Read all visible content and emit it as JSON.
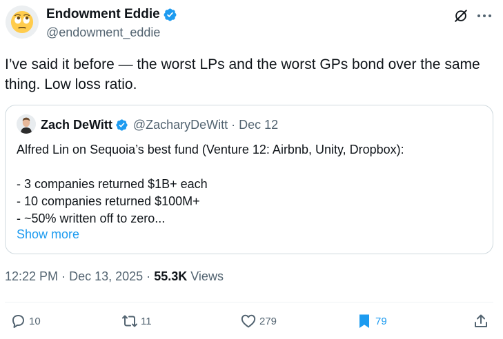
{
  "tweet": {
    "author": {
      "name": "Endowment Eddie",
      "handle": "@endowment_eddie",
      "avatar_icon": "face-with-rolling-eyes-emoji",
      "verified": true
    },
    "text": "I’ve said it before — the worst LPs and the worst GPs bond over the same thing. Low loss ratio.",
    "quote": {
      "author_name": "Zach DeWitt",
      "handle": "@ZacharyDeWitt",
      "separator": "·",
      "date": "Dec 12",
      "lines": [
        "Alfred Lin on Sequoia’s best fund (Venture 12: Airbnb, Unity, Dropbox):",
        "",
        "- 3 companies returned $1B+ each",
        "- 10 companies returned $100M+",
        "- ~50% written off to zero..."
      ],
      "show_more": "Show more"
    },
    "meta": {
      "time": "12:22 PM",
      "separator": "·",
      "date": "Dec 13, 2025",
      "views_count": "55.3K",
      "views_label": "Views"
    },
    "actions": {
      "replies": "10",
      "retweets": "11",
      "likes": "279",
      "bookmarks": "79"
    },
    "colors": {
      "accent": "#1d9bf0",
      "secondary_text": "#536471",
      "primary_text": "#0f1419",
      "border": "#cfd9de"
    }
  }
}
